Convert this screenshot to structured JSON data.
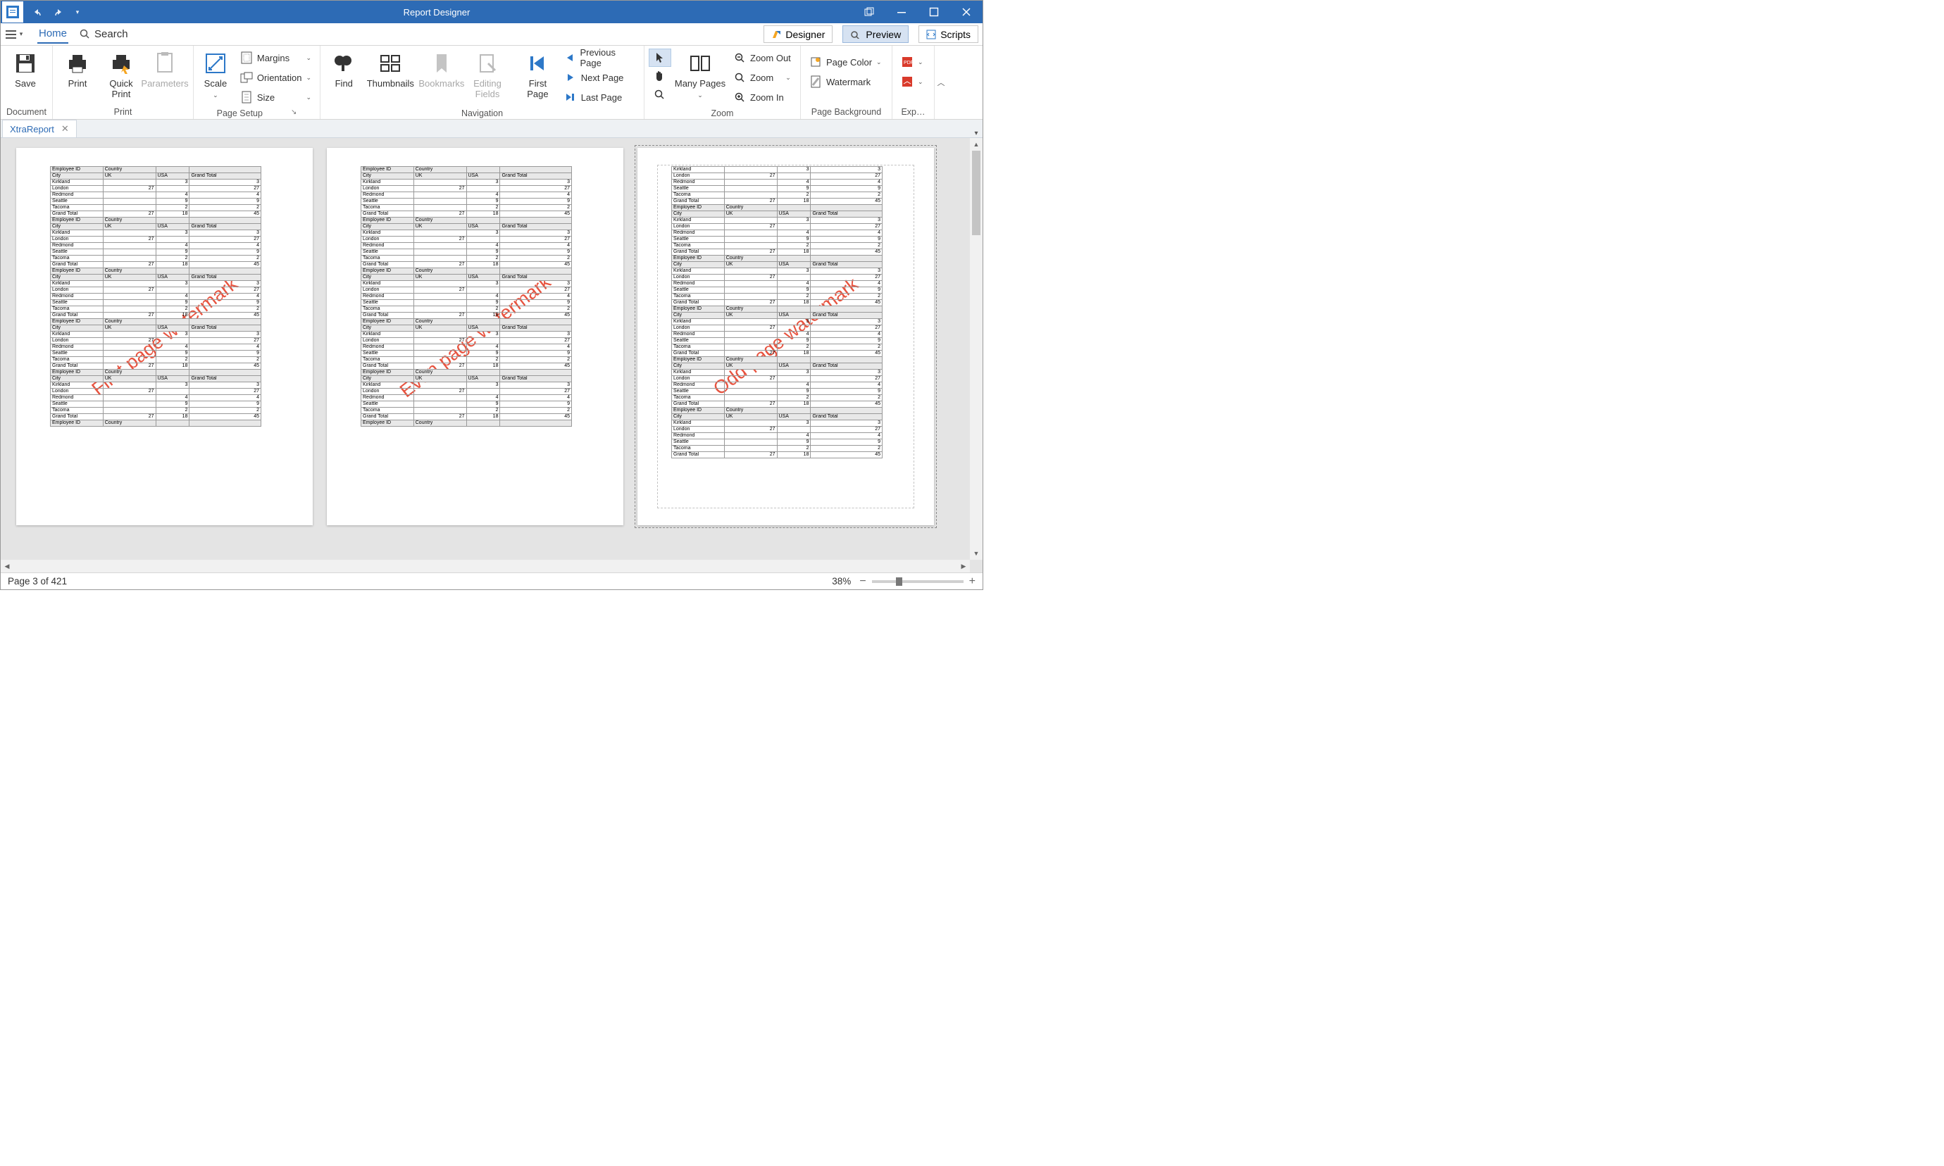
{
  "titlebar": {
    "title": "Report Designer"
  },
  "tabs": {
    "home": "Home",
    "search": "Search",
    "designer": "Designer",
    "preview": "Preview",
    "scripts": "Scripts"
  },
  "ribbon": {
    "save": "Save",
    "print": "Print",
    "quickprint": "Quick\nPrint",
    "parameters": "Parameters",
    "scale": "Scale",
    "margins": "Margins",
    "orientation": "Orientation",
    "size": "Size",
    "find": "Find",
    "thumbnails": "Thumbnails",
    "bookmarks": "Bookmarks",
    "editing": "Editing\nFields",
    "firstpage": "First\nPage",
    "prevpage": "Previous Page",
    "nextpage": "Next  Page",
    "lastpage": "Last  Page",
    "manypages": "Many Pages",
    "zoomout": "Zoom Out",
    "zoom": "Zoom",
    "zoomin": "Zoom In",
    "pagecolor": "Page Color",
    "watermark": "Watermark",
    "g_document": "Document",
    "g_print": "Print",
    "g_pagesetup": "Page Setup",
    "g_nav": "Navigation",
    "g_zoom": "Zoom",
    "g_pagebg": "Page Background",
    "g_export": "Exp…"
  },
  "doctab": "XtraReport",
  "watermarks": {
    "p1": "First page watermark",
    "p2": "Even page watermark",
    "p3": "Odd page watermark"
  },
  "tbl": {
    "emp": "Employee ID",
    "country": "Country",
    "city": "City",
    "uk": "UK",
    "usa": "USA",
    "gt": "Grand Total",
    "rows": [
      {
        "c": "Kirkland",
        "uk": "",
        "usa": "3",
        "gt": "3"
      },
      {
        "c": "London",
        "uk": "27",
        "usa": "",
        "gt": "27"
      },
      {
        "c": "Redmond",
        "uk": "",
        "usa": "4",
        "gt": "4"
      },
      {
        "c": "Seattle",
        "uk": "",
        "usa": "9",
        "gt": "9"
      },
      {
        "c": "Tacoma",
        "uk": "",
        "usa": "2",
        "gt": "2"
      }
    ],
    "tot": {
      "uk": "27",
      "usa": "18",
      "gt": "45"
    }
  },
  "status": {
    "page": "Page 3 of 421",
    "zoom": "38%"
  }
}
